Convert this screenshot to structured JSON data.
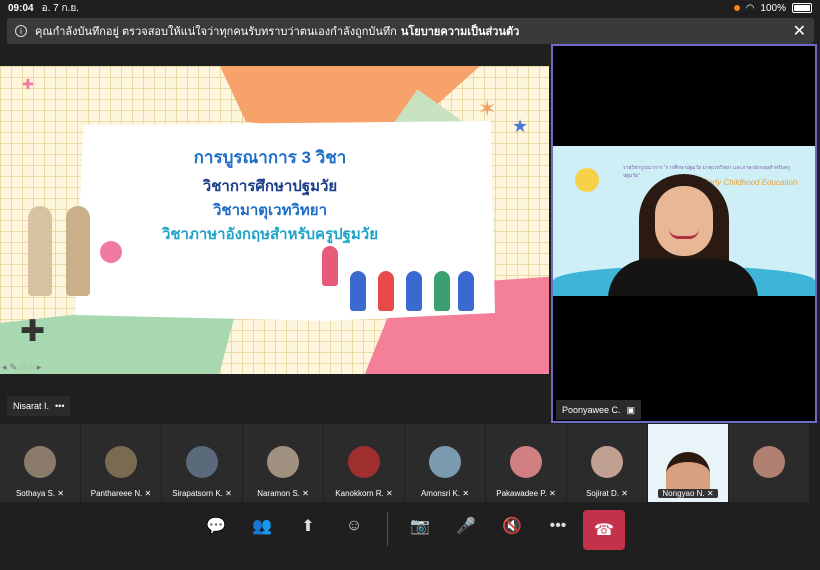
{
  "status_bar": {
    "time": "09:04",
    "date": "อ. 7 ก.ย.",
    "battery": "100%"
  },
  "recording_banner": {
    "message": "คุณกำลังบันทึกอยู่ ตรวจสอบให้แน่ใจว่าทุกคนรับทราบว่าตนเองกำลังถูกบันทึก",
    "link": "นโยบายความเป็นส่วนตัว"
  },
  "slide": {
    "title": "การบูรณาการ 3 วิชา",
    "line1": "วิชาการศึกษาปฐมวัย",
    "line2": "วิชามาตุเวทวิทยา",
    "line3": "วิชาภาษาอังกฤษสำหรับครูปฐมวัย"
  },
  "presenter": {
    "name": "Nisarat I.",
    "more_icon": "more-icon"
  },
  "video": {
    "name": "Poonyawee C.",
    "banner_text": "รายวิชาบูรณาการ \"การศึกษาปฐมวัย มาตุเวทวิทยา และภาษาอังกฤษสำหรับครูปฐมวัย\"",
    "overlay": "Early Childhood Education"
  },
  "participants": [
    {
      "name": "Sothaya S.",
      "color": "#8a7a6a"
    },
    {
      "name": "Panthareee N.",
      "color": "#7a6a50"
    },
    {
      "name": "Sirapatsorn K.",
      "color": "#5a6a7a"
    },
    {
      "name": "Naramon S.",
      "color": "#a09080"
    },
    {
      "name": "Kanokkorn R.",
      "color": "#a03030"
    },
    {
      "name": "Amonsri K.",
      "color": "#7a9ab0"
    },
    {
      "name": "Pakawadee P.",
      "color": "#d08080"
    },
    {
      "name": "Sojirat D.",
      "color": "#c0a090"
    },
    {
      "name": "Nongyao N.",
      "color": "#d9a07f"
    },
    {
      "name": "",
      "color": "#b08070"
    }
  ],
  "controls": [
    "chat-icon",
    "people-icon",
    "share-icon",
    "reactions-icon",
    "camera-off-icon",
    "mic-off-icon",
    "speaker-off-icon",
    "more-icon",
    "hangup-icon"
  ]
}
